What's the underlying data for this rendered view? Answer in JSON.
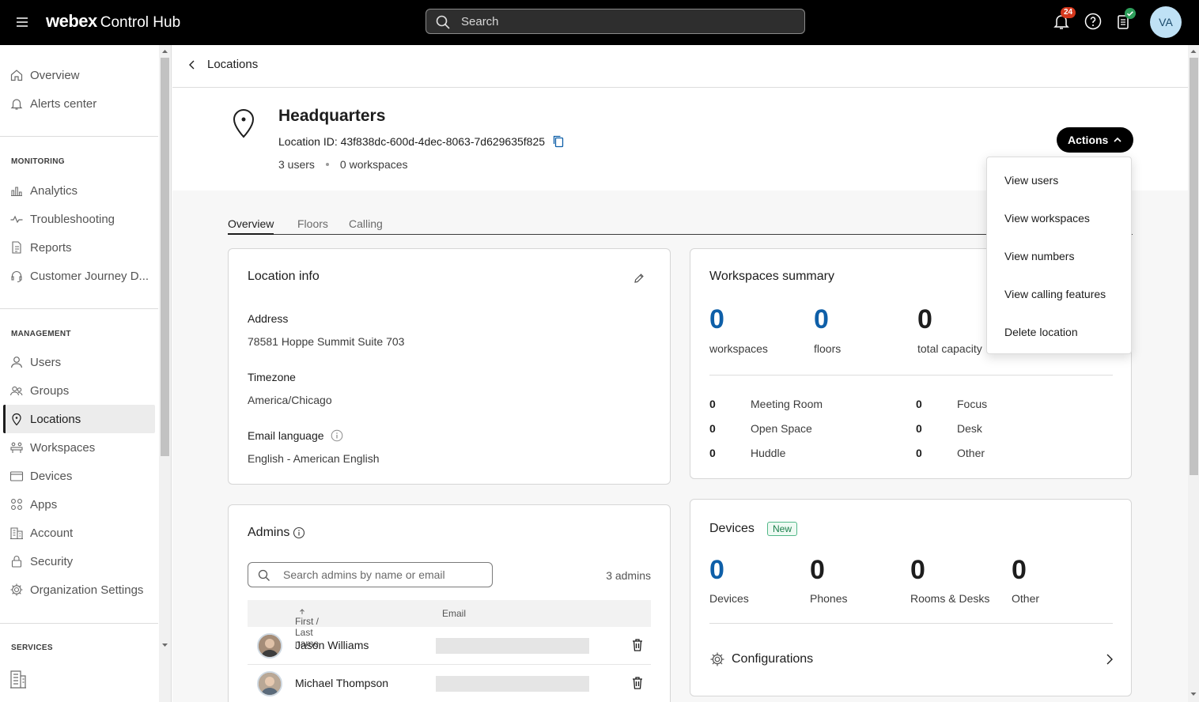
{
  "topbar": {
    "brand_primary": "webex",
    "brand_secondary": "Control Hub",
    "search_placeholder": "Search",
    "notification_count": "24",
    "user_initials": "VA"
  },
  "sidebar": {
    "top_items": [
      {
        "label": "Overview",
        "icon": "home-icon"
      },
      {
        "label": "Alerts center",
        "icon": "bell-icon"
      }
    ],
    "monitoring_heading": "MONITORING",
    "monitoring_items": [
      {
        "label": "Analytics",
        "icon": "bar-chart-icon"
      },
      {
        "label": "Troubleshooting",
        "icon": "pulse-icon"
      },
      {
        "label": "Reports",
        "icon": "document-icon"
      },
      {
        "label": "Customer Journey D...",
        "icon": "headset-icon"
      }
    ],
    "management_heading": "MANAGEMENT",
    "management_items": [
      {
        "label": "Users",
        "icon": "user-icon"
      },
      {
        "label": "Groups",
        "icon": "group-icon"
      },
      {
        "label": "Locations",
        "icon": "location-pin-icon",
        "active": true
      },
      {
        "label": "Workspaces",
        "icon": "workspaces-icon"
      },
      {
        "label": "Devices",
        "icon": "device-icon"
      },
      {
        "label": "Apps",
        "icon": "apps-grid-icon"
      },
      {
        "label": "Account",
        "icon": "building-icon"
      },
      {
        "label": "Security",
        "icon": "lock-icon"
      },
      {
        "label": "Organization Settings",
        "icon": "gear-icon"
      }
    ],
    "services_heading": "SERVICES"
  },
  "breadcrumb": {
    "back_label": "Locations"
  },
  "location": {
    "name": "Headquarters",
    "id_line": "Location ID: 43f838dc-600d-4dec-8063-7d629635f825",
    "users": "3 users",
    "workspaces": "0 workspaces"
  },
  "actions": {
    "label": "Actions",
    "menu": [
      "View users",
      "View workspaces",
      "View numbers",
      "View calling features",
      "Delete location"
    ]
  },
  "tabs": [
    "Overview",
    "Floors",
    "Calling"
  ],
  "location_info": {
    "title": "Location info",
    "address_label": "Address",
    "address_value": "78581 Hoppe Summit Suite 703",
    "timezone_label": "Timezone",
    "timezone_value": "America/Chicago",
    "email_label": "Email language",
    "email_value": "English - American English"
  },
  "workspaces_summary": {
    "title": "Workspaces summary",
    "stats": [
      {
        "value": "0",
        "label": "workspaces"
      },
      {
        "value": "0",
        "label": "floors"
      },
      {
        "value": "0",
        "label": "total capacity"
      }
    ],
    "breakdown_left": [
      {
        "count": "0",
        "label": "Meeting Room"
      },
      {
        "count": "0",
        "label": "Open Space"
      },
      {
        "count": "0",
        "label": "Huddle"
      }
    ],
    "breakdown_right": [
      {
        "count": "0",
        "label": "Focus"
      },
      {
        "count": "0",
        "label": "Desk"
      },
      {
        "count": "0",
        "label": "Other"
      }
    ]
  },
  "admins": {
    "title": "Admins",
    "search_placeholder": "Search admins by name or email",
    "count": "3 admins",
    "col_name": "First / Last name",
    "col_email": "Email",
    "rows": [
      {
        "name": "Jason Williams"
      },
      {
        "name": "Michael Thompson"
      }
    ]
  },
  "devices": {
    "title": "Devices",
    "badge": "New",
    "stats": [
      {
        "value": "0",
        "label": "Devices"
      },
      {
        "value": "0",
        "label": "Phones"
      },
      {
        "value": "0",
        "label": "Rooms & Desks"
      },
      {
        "value": "0",
        "label": "Other"
      }
    ],
    "configurations_label": "Configurations"
  },
  "colors": {
    "accent_blue": "#0e5fa8",
    "notification_red": "#d4371c",
    "status_green": "#2e9e5b"
  }
}
